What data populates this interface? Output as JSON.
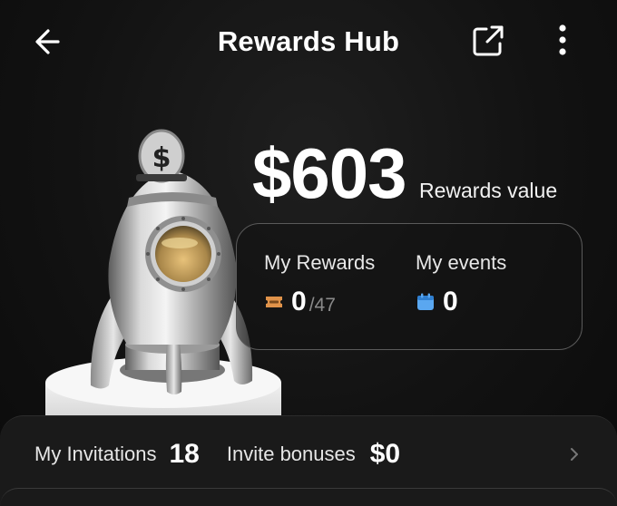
{
  "header": {
    "title": "Rewards Hub",
    "back_icon": "arrow-left-icon",
    "share_icon": "external-link-icon",
    "more_icon": "more-vertical-icon"
  },
  "summary": {
    "amount": "$603",
    "label": "Rewards value"
  },
  "stats": {
    "rewards": {
      "label": "My Rewards",
      "value": "0",
      "total": "/47",
      "icon": "ticket-icon",
      "icon_color": "#E0934A"
    },
    "events": {
      "label": "My events",
      "value": "0",
      "icon": "calendar-icon",
      "icon_color": "#5AA7F0"
    }
  },
  "invites": {
    "invitations_label": "My Invitations",
    "invitations_count": "18",
    "bonuses_label": "Invite bonuses",
    "bonuses_value": "$0"
  },
  "hero_icon": "rocket-piggy-bank-icon"
}
